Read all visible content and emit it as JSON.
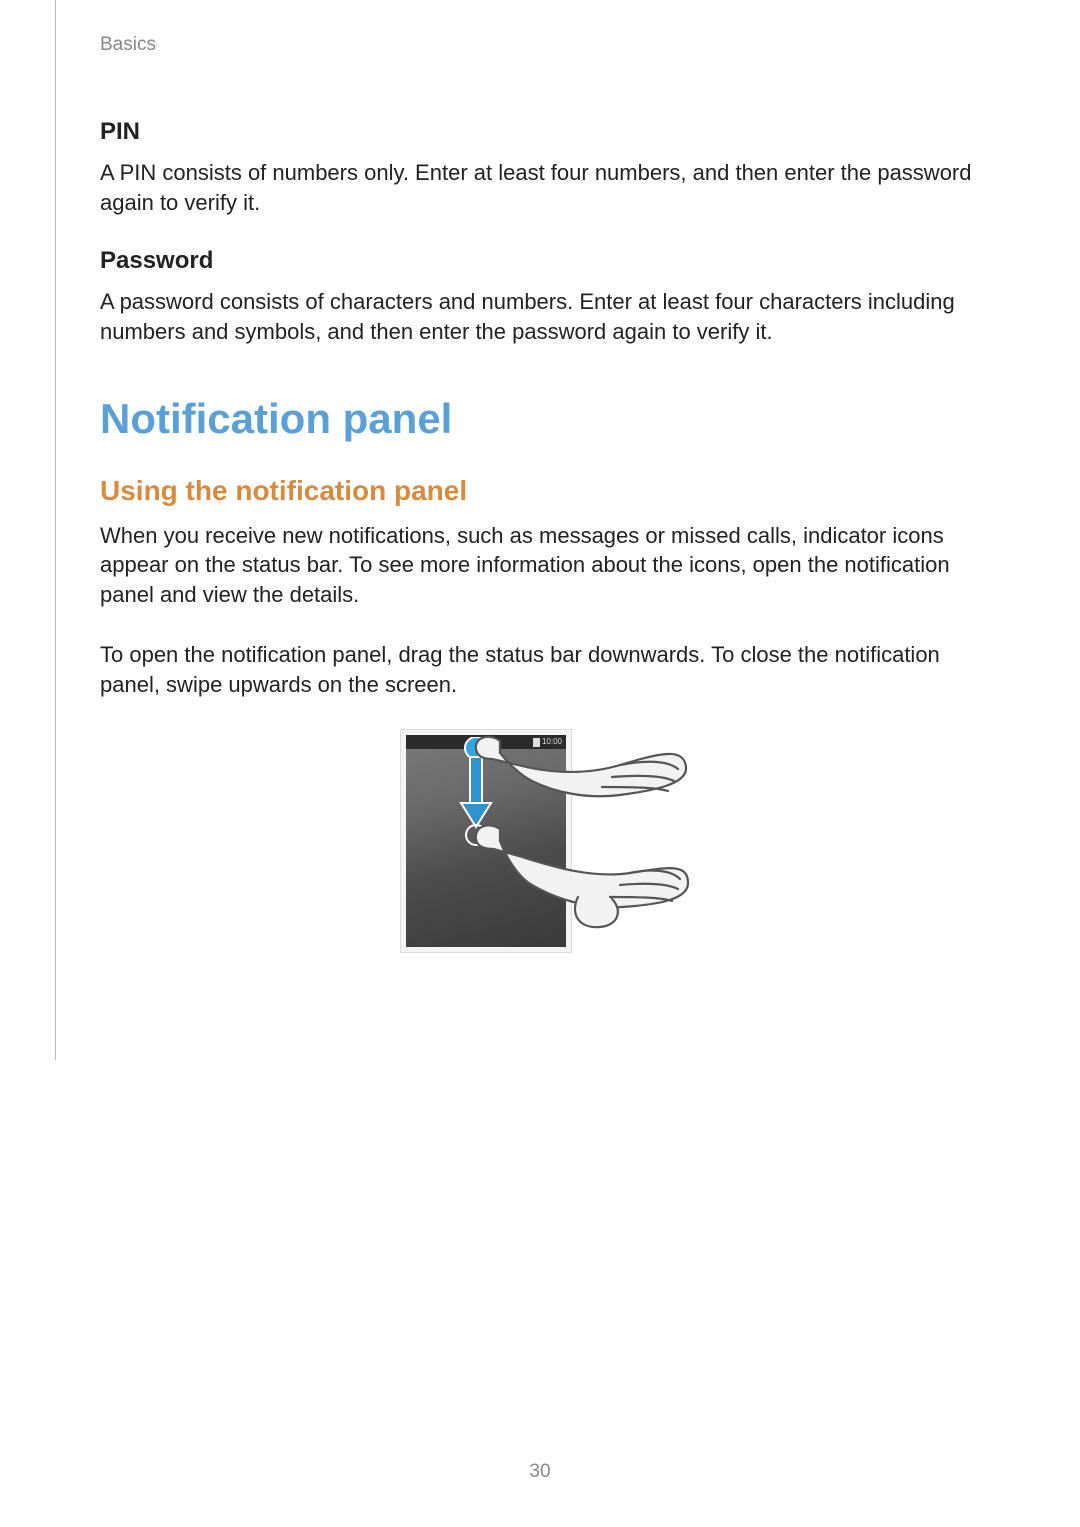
{
  "header": {
    "section": "Basics"
  },
  "pin": {
    "heading": "PIN",
    "body": "A PIN consists of numbers only. Enter at least four numbers, and then enter the password again to verify it."
  },
  "password": {
    "heading": "Password",
    "body": "A password consists of characters and numbers. Enter at least four characters including numbers and symbols, and then enter the password again to verify it."
  },
  "notification": {
    "title": "Notification panel",
    "subheading": "Using the notification panel",
    "p1": "When you receive new notifications, such as messages or missed calls, indicator icons appear on the status bar. To see more information about the icons, open the notification panel and view the details.",
    "p2": "To open the notification panel, drag the status bar downwards. To close the notification panel, swipe upwards on the screen."
  },
  "illustration": {
    "status_time": "10:00"
  },
  "page_number": "30"
}
